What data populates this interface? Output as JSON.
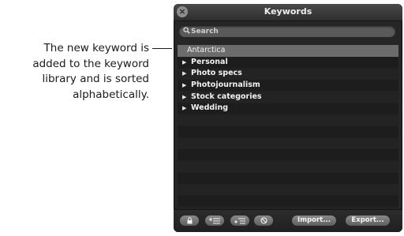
{
  "callout": {
    "lines": [
      "The new keyword is",
      "added to the keyword",
      "library and is sorted",
      "alphabetically."
    ]
  },
  "panel": {
    "title": "Keywords",
    "search": {
      "placeholder": "Search",
      "value": ""
    },
    "keywords": [
      {
        "label": "Antarctica",
        "selected": true,
        "expandable": false
      },
      {
        "label": "Personal",
        "selected": false,
        "expandable": true
      },
      {
        "label": "Photo specs",
        "selected": false,
        "expandable": true
      },
      {
        "label": "Photojournalism",
        "selected": false,
        "expandable": true
      },
      {
        "label": "Stock categories",
        "selected": false,
        "expandable": true
      },
      {
        "label": "Wedding",
        "selected": false,
        "expandable": true
      }
    ],
    "footer": {
      "lock_button": "lock-icon",
      "add_keyword_button": "add-keyword-icon",
      "add_subkeyword_button": "add-subkeyword-icon",
      "delete_button": "delete-icon",
      "import_label": "Import...",
      "export_label": "Export..."
    }
  },
  "icons": {
    "close": "close-icon",
    "search": "search-icon",
    "disclosure": "disclosure-triangle-icon"
  }
}
